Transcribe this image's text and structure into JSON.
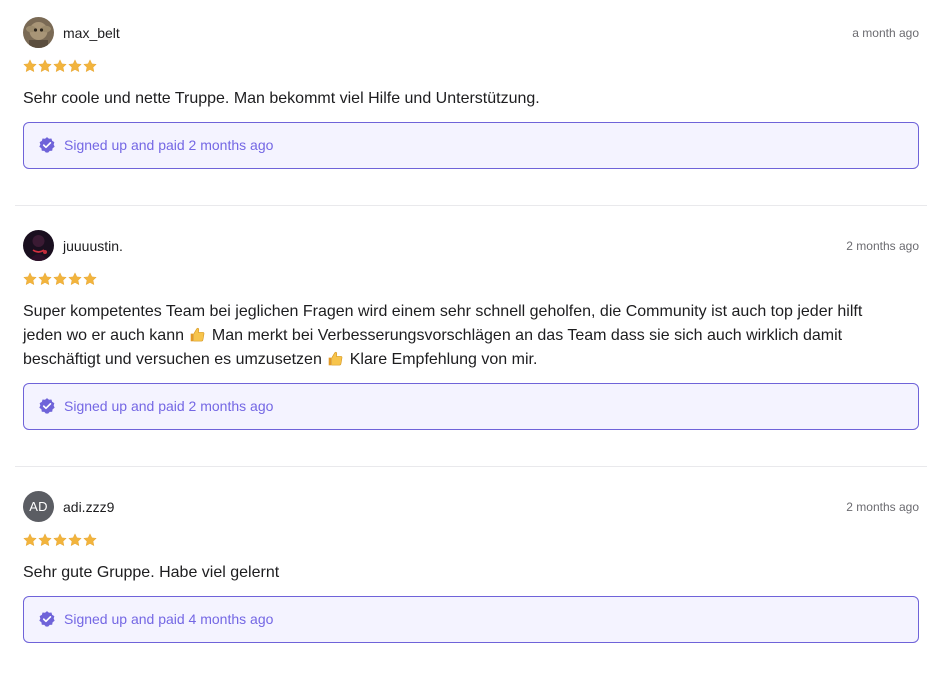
{
  "colors": {
    "accent": "#6f63d9",
    "accent_text": "#7467e4",
    "accent_bg": "#f4f3ff",
    "star": "#f2b43d",
    "divider": "#e9e9ec"
  },
  "reviews": [
    {
      "username": "max_belt",
      "time": "a month ago",
      "rating": 5,
      "avatar_icon": "user-photo-avatar",
      "text": "Sehr coole und nette Truppe. Man bekommt viel Hilfe und Unterstützung.",
      "verified_label": "Signed up and paid 2 months ago"
    },
    {
      "username": "juuuustin.",
      "time": "2 months ago",
      "rating": 5,
      "avatar_icon": "user-photo-avatar",
      "text_parts": [
        "Super kompetentes Team bei jeglichen Fragen wird einem sehr schnell geholfen, die Community ist auch top jeder hilft jeden wo er auch kann ",
        " Man merkt bei Verbesserungsvorschlägen an das Team dass sie sich auch wirklich damit beschäftigt und versuchen es umzusetzen ",
        " Klare Empfehlung von mir."
      ],
      "emoji": "thumbs-up-icon",
      "verified_label": "Signed up and paid 2 months ago"
    },
    {
      "username": "adi.zzz9",
      "time": "2 months ago",
      "rating": 5,
      "avatar_initials": "AD",
      "text": "Sehr gute Gruppe. Habe viel gelernt",
      "verified_label": "Signed up and paid 4 months ago"
    }
  ]
}
